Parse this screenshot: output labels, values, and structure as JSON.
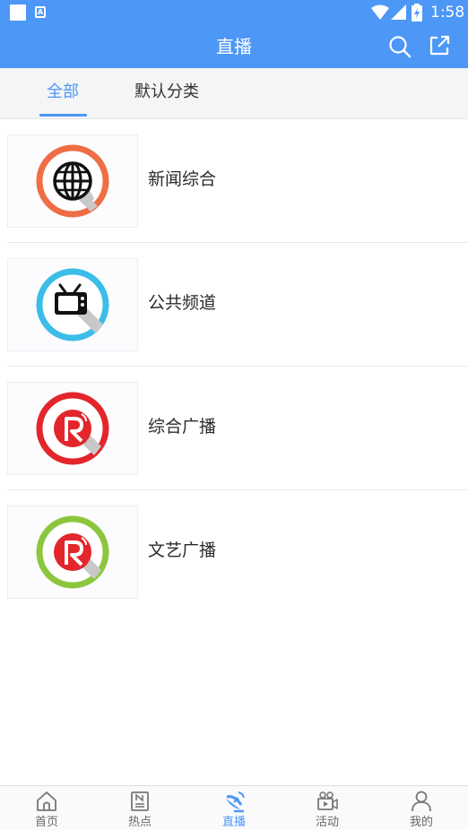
{
  "status_bar": {
    "time": "1:58",
    "notification_icon": "a-badge-icon"
  },
  "header": {
    "title": "直播",
    "search_icon": "search-icon",
    "share_icon": "share-icon"
  },
  "tabs": [
    {
      "label": "全部",
      "active": true
    },
    {
      "label": "默认分类",
      "active": false
    }
  ],
  "channels": [
    {
      "name": "新闻综合",
      "icon": "globe-icon",
      "ring_color": "#ee6e45"
    },
    {
      "name": "公共频道",
      "icon": "tv-icon",
      "ring_color": "#3cbde8"
    },
    {
      "name": "综合广播",
      "icon": "radio-r-icon",
      "ring_color": "#e2262b"
    },
    {
      "name": "文艺广播",
      "icon": "radio-r-icon",
      "ring_color": "#8cc63f"
    }
  ],
  "bottom_nav": [
    {
      "label": "首页",
      "icon": "home-icon",
      "active": false
    },
    {
      "label": "热点",
      "icon": "news-icon",
      "active": false
    },
    {
      "label": "直播",
      "icon": "satellite-icon",
      "active": true
    },
    {
      "label": "活动",
      "icon": "video-camera-icon",
      "active": false
    },
    {
      "label": "我的",
      "icon": "person-icon",
      "active": false
    }
  ],
  "colors": {
    "primary": "#4d97f6",
    "inactive_text": "#666666"
  }
}
